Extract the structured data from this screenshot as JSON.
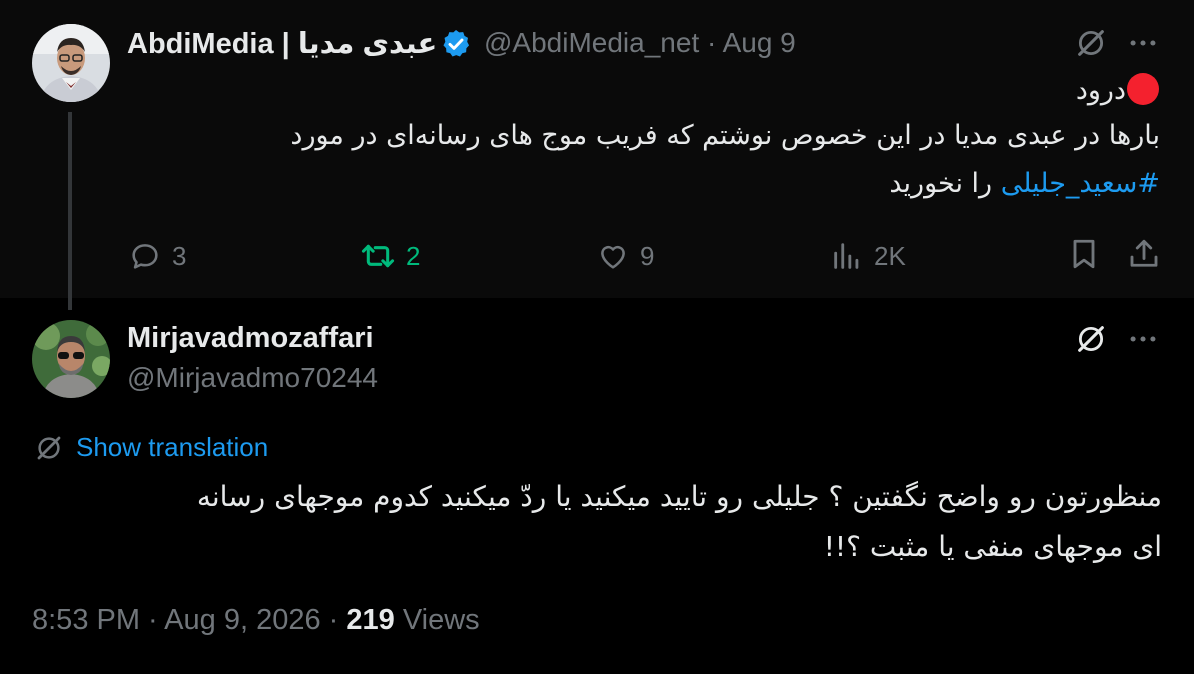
{
  "parent": {
    "display_name": "AbdiMedia | عبدی مدیا",
    "handle": "@AbdiMedia_net",
    "separator": "·",
    "date": "Aug 9",
    "line1": "درود",
    "line2": "بارها در عبدی مدیا در این خصوص نوشتم که فریب موج های رسانه‌ای در مورد",
    "line3_hashtag": "#سعید_جلیلی",
    "line3_rest": " را نخورید",
    "stats": {
      "replies": "3",
      "reposts": "2",
      "likes": "9",
      "views": "2K"
    }
  },
  "reply": {
    "display_name": "Mirjavadmozaffari",
    "handle": "@Mirjavadmo70244",
    "translate_label": "Show translation",
    "line1": "منظورتون رو واضح نگفتین ؟ جلیلی رو تایید میکنید یا ردّ میکنید کدوم موجهای رسانه",
    "line2": "ای موجهای منفی یا مثبت ؟!!",
    "time": "8:53 PM",
    "sep1": " · ",
    "date": "Aug 9, 2026",
    "sep2": " · ",
    "views_count": "219",
    "views_label": " Views"
  },
  "colors": {
    "background": "#000000",
    "parent_background": "#0a0a0a",
    "text": "#e7e9ea",
    "muted": "#71767b",
    "accent": "#1d9bf0",
    "repost": "#00ba7c",
    "red_dot": "#f4212e"
  },
  "icons": [
    "verified-badge-icon",
    "grok-icon",
    "more-icon",
    "reply-icon",
    "repost-icon",
    "like-icon",
    "views-icon",
    "bookmark-icon",
    "share-icon",
    "translate-icon",
    "red-circle-emoji"
  ]
}
